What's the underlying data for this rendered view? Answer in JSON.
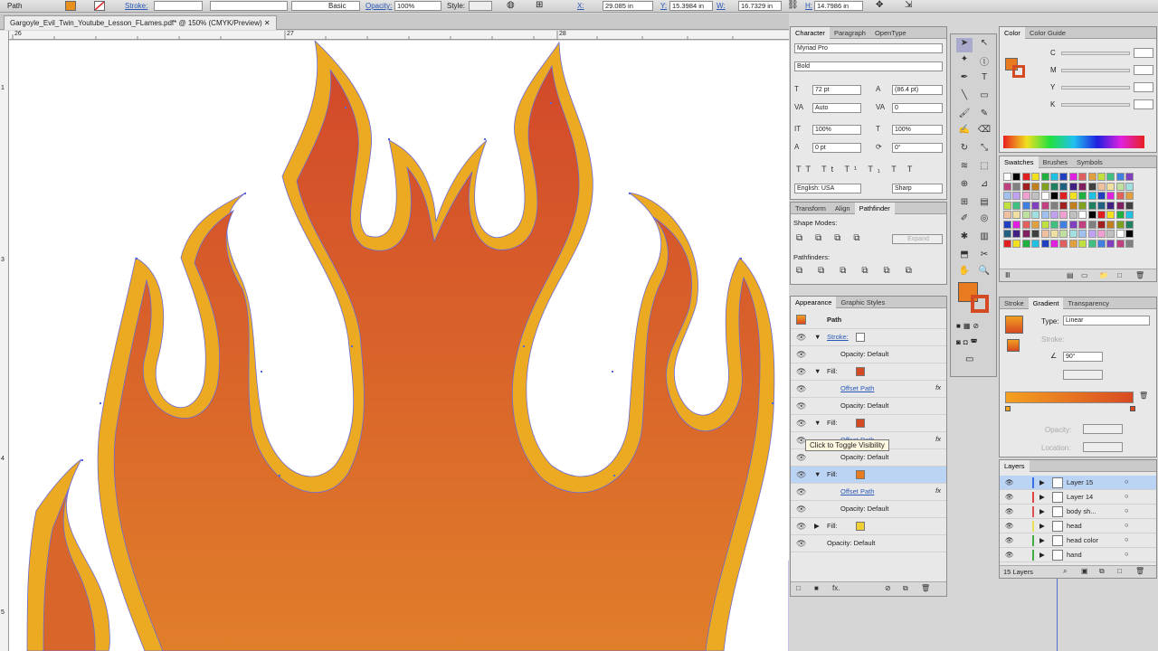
{
  "control_bar": {
    "type_label": "Path",
    "stroke_label": "Stroke:",
    "stroke_style": "Basic",
    "opacity_label": "Opacity:",
    "opacity_value": "100%",
    "style_label": "Style:",
    "x_label": "X:",
    "x_value": "29.085 in",
    "y_label": "Y:",
    "y_value": "15.3984 in",
    "w_label": "W:",
    "w_value": "16.7329 in",
    "h_label": "H:",
    "h_value": "14.7986 in",
    "fill_color": "#e8901c",
    "stroke_color": "#d44a22"
  },
  "document": {
    "tab_title": "Gargoyle_Evil_Twin_Youtube_Lesson_FLames.pdf* @ 150% (CMYK/Preview)"
  },
  "ruler": {
    "top_labels": [
      "26",
      "27",
      "28"
    ],
    "left_labels": [
      "1",
      "3",
      "4",
      "5"
    ]
  },
  "character_panel": {
    "tabs": [
      "Character",
      "Paragraph",
      "OpenType"
    ],
    "font_family": "Myriad Pro",
    "font_style": "Bold",
    "font_size": "72 pt",
    "leading": "(86.4 pt)",
    "kerning": "Auto",
    "tracking": "0",
    "vertical_scale": "100%",
    "horizontal_scale": "100%",
    "baseline_shift": "0 pt",
    "rotation": "0°",
    "language": "English: USA",
    "antialias": "Sharp"
  },
  "transform_panel": {
    "tabs": [
      "Transform",
      "Align",
      "Pathfinder"
    ],
    "shape_modes_label": "Shape Modes:",
    "expand_label": "Expand",
    "pathfinders_label": "Pathfinders:"
  },
  "appearance_panel": {
    "tabs": [
      "Appearance",
      "Graphic Styles"
    ],
    "object_label": "Path",
    "rows": [
      {
        "label": "Stroke:",
        "indent": 0,
        "link": true
      },
      {
        "label": "Opacity: Default",
        "indent": 1,
        "link": false
      },
      {
        "label": "Fill:",
        "indent": 0,
        "link": false
      },
      {
        "label": "Offset Path",
        "indent": 1,
        "link": true
      },
      {
        "label": "Opacity: Default",
        "indent": 1,
        "link": false
      },
      {
        "label": "Fill:",
        "indent": 0,
        "link": false
      },
      {
        "label": "Offset Path",
        "indent": 1,
        "link": true
      },
      {
        "label": "Opacity: Default",
        "indent": 1,
        "link": false
      },
      {
        "label": "Fill:",
        "indent": 0,
        "link": false,
        "selected": true
      },
      {
        "label": "Offset Path",
        "indent": 1,
        "link": true
      },
      {
        "label": "Opacity: Default",
        "indent": 1,
        "link": false
      },
      {
        "label": "Fill:",
        "indent": 0,
        "link": false
      },
      {
        "label": "Opacity: Default",
        "indent": 0,
        "link": false
      }
    ],
    "tooltip": "Click to Toggle Visibility"
  },
  "color_panel": {
    "tabs": [
      "Color",
      "Color Guide"
    ],
    "channels": [
      "C",
      "M",
      "Y",
      "K"
    ]
  },
  "swatches_panel": {
    "tabs": [
      "Swatches",
      "Brushes",
      "Symbols"
    ]
  },
  "gradient_panel": {
    "tabs": [
      "Stroke",
      "Gradient",
      "Transparency"
    ],
    "type_label": "Type:",
    "type_value": "Linear",
    "stroke_label": "Stroke:",
    "angle_value": "90°",
    "opacity_label": "Opacity:",
    "location_label": "Location:",
    "start_color": "#f4a020",
    "end_color": "#d84a22"
  },
  "layers_panel": {
    "tab": "Layers",
    "layers": [
      {
        "name": "Layer 15",
        "color": "#3b6fe0"
      },
      {
        "name": "Layer 14",
        "color": "#d44"
      },
      {
        "name": "body sh...",
        "color": "#e05050"
      },
      {
        "name": "head",
        "color": "#e8e050"
      },
      {
        "name": "head color",
        "color": "#44aa44"
      },
      {
        "name": "hand",
        "color": "#44aa44"
      }
    ],
    "count_label": "15 Layers"
  },
  "tools": {
    "fill_color": "#e87a20",
    "stroke_color": "#d44a22"
  }
}
